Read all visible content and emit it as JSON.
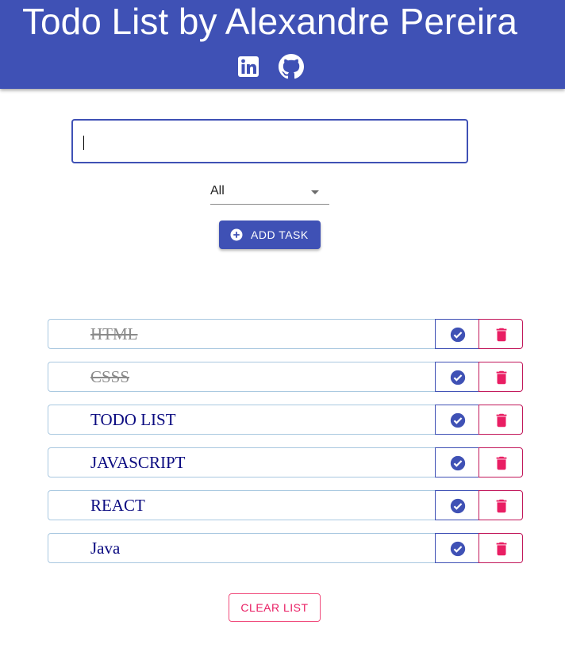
{
  "header": {
    "title": "Todo List by Alexandre Pereira",
    "links": [
      {
        "icon": "linkedin-icon"
      },
      {
        "icon": "github-icon"
      }
    ]
  },
  "task_input": {
    "value": "",
    "placeholder": ""
  },
  "filter": {
    "selected": "All"
  },
  "add_button": {
    "label": "ADD TASK",
    "icon": "plus-circle-icon"
  },
  "tasks": [
    {
      "text": "HTML",
      "completed": true
    },
    {
      "text": "CSSS",
      "completed": true
    },
    {
      "text": "TODO LIST",
      "completed": false
    },
    {
      "text": "JAVASCRIPT",
      "completed": false
    },
    {
      "text": "REACT",
      "completed": false
    },
    {
      "text": "Java",
      "completed": false
    }
  ],
  "clear_button": {
    "label": "CLEAR LIST"
  },
  "colors": {
    "primary": "#3f51b5",
    "secondary": "#e91e63",
    "task_text": "#0a0a80",
    "completed_text": "#8a8a8a"
  }
}
